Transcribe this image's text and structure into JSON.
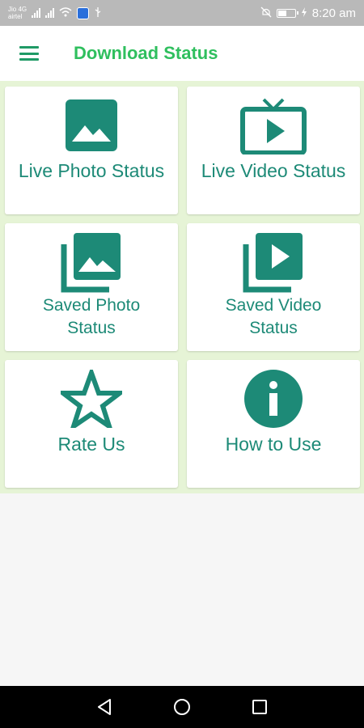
{
  "status_bar": {
    "carrier_top": "Jio 4G",
    "carrier_bottom": "airtel",
    "time": "8:20 am"
  },
  "app_bar": {
    "title": "Download Status",
    "menu_icon": "hamburger-menu-icon"
  },
  "tiles": [
    {
      "label": "Live Photo Status",
      "icon": "photo-icon"
    },
    {
      "label": "Live Video Status",
      "icon": "tv-play-icon"
    },
    {
      "label": "Saved Photo Status",
      "line1": "Saved Photo",
      "line2": "Status",
      "icon": "photo-library-icon"
    },
    {
      "label": "Saved Video Status",
      "line1": "Saved Video",
      "line2": "Status",
      "icon": "video-library-icon"
    },
    {
      "label": "Rate Us",
      "icon": "star-icon"
    },
    {
      "label": "How to Use",
      "icon": "info-icon"
    }
  ],
  "nav_bar": {
    "back_icon": "back-icon",
    "home_icon": "home-icon",
    "recents_icon": "recents-icon"
  },
  "colors": {
    "accent": "#1d8a77",
    "title_green": "#2fbf5e",
    "grid_background": "#e6f4d6"
  }
}
